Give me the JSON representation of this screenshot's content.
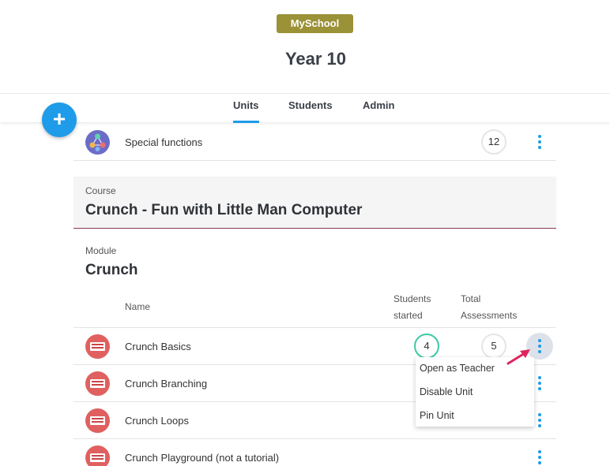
{
  "header": {
    "school_badge": "MySchool",
    "title": "Year 10"
  },
  "tabs": [
    {
      "label": "Units",
      "active": true
    },
    {
      "label": "Students",
      "active": false
    },
    {
      "label": "Admin",
      "active": false
    }
  ],
  "fab": {
    "label": "+"
  },
  "top_unit": {
    "name": "Special functions",
    "total": "12"
  },
  "course": {
    "label": "Course",
    "title": "Crunch - Fun with Little Man Computer"
  },
  "module": {
    "label": "Module",
    "title": "Crunch"
  },
  "columns": {
    "name": "Name",
    "students_started_1": "Students",
    "students_started_2": "started",
    "total_1": "Total",
    "total_2": "Assessments"
  },
  "units": [
    {
      "name": "Crunch Basics",
      "started": "4",
      "total": "5"
    },
    {
      "name": "Crunch Branching",
      "started": "",
      "total": ""
    },
    {
      "name": "Crunch Loops",
      "started": "",
      "total": ""
    },
    {
      "name": "Crunch Playground (not a tutorial)",
      "started": "",
      "total": ""
    }
  ],
  "context_menu": {
    "items": [
      "Open as Teacher",
      "Disable Unit",
      "Pin Unit"
    ]
  },
  "colors": {
    "accent": "#1e9be9",
    "badge": "#9b9136",
    "arrow": "#e0245e",
    "started_ring": "#3ec9a5"
  }
}
